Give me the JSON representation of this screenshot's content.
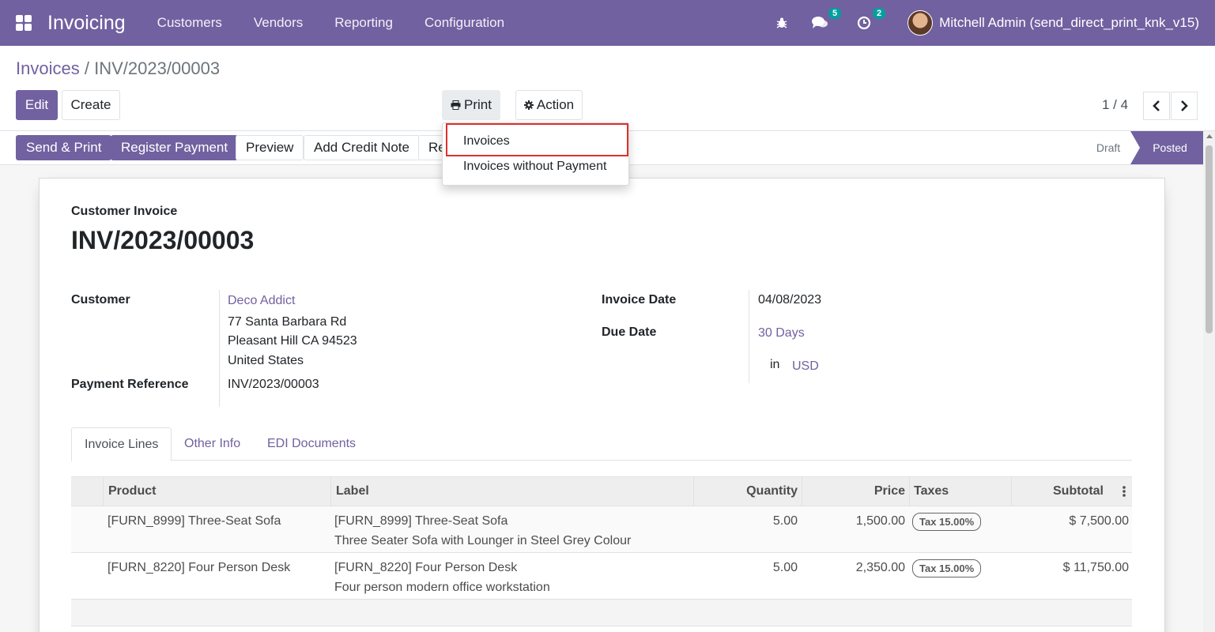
{
  "navbar": {
    "app_name": "Invoicing",
    "menu": [
      "Customers",
      "Vendors",
      "Reporting",
      "Configuration"
    ],
    "messages_count": "5",
    "activities_count": "2",
    "user_name": "Mitchell Admin (send_direct_print_knk_v15)",
    "icons": [
      "apps-icon",
      "bug-icon",
      "chat-icon",
      "clock-icon",
      "user-avatar"
    ]
  },
  "breadcrumb": {
    "parent": "Invoices",
    "separator": "/",
    "current": "INV/2023/00003"
  },
  "buttons": {
    "edit": "Edit",
    "create": "Create",
    "print": "Print",
    "action": "Action"
  },
  "pager": {
    "value": "1 / 4"
  },
  "print_menu": {
    "items": [
      "Invoices",
      "Invoices without Payment"
    ]
  },
  "statusbar": {
    "send_print": "Send & Print",
    "register_payment": "Register Payment",
    "preview": "Preview",
    "add_credit_note": "Add Credit Note",
    "reset_partial": "Re",
    "stages": [
      "Draft",
      "Posted"
    ],
    "active_stage": "Posted"
  },
  "invoice": {
    "type_label": "Customer Invoice",
    "number": "INV/2023/00003",
    "customer_label": "Customer",
    "customer_name": "Deco Addict",
    "address_line1": "77 Santa Barbara Rd",
    "address_line2": "Pleasant Hill CA 94523",
    "address_line3": "United States",
    "payment_ref_label": "Payment Reference",
    "payment_ref": "INV/2023/00003",
    "invoice_date_label": "Invoice Date",
    "invoice_date": "04/08/2023",
    "due_date_label": "Due Date",
    "due_date": "30 Days",
    "currency_prefix": "in",
    "currency": "USD"
  },
  "tabs": [
    "Invoice Lines",
    "Other Info",
    "EDI Documents"
  ],
  "lines_table": {
    "columns": [
      "Product",
      "Label",
      "Quantity",
      "Price",
      "Taxes",
      "Subtotal"
    ],
    "rows": [
      {
        "product": "[FURN_8999] Three-Seat Sofa",
        "label_line1": "[FURN_8999] Three-Seat Sofa",
        "label_line2": "Three Seater Sofa with Lounger in Steel Grey Colour",
        "quantity": "5.00",
        "price": "1,500.00",
        "tax": "Tax 15.00%",
        "subtotal": "$ 7,500.00"
      },
      {
        "product": "[FURN_8220] Four Person Desk",
        "label_line1": "[FURN_8220] Four Person Desk",
        "label_line2": "Four person modern office workstation",
        "quantity": "5.00",
        "price": "2,350.00",
        "tax": "Tax 15.00%",
        "subtotal": "$ 11,750.00"
      }
    ]
  },
  "colors": {
    "brand": "#7161a0",
    "highlight_border": "#e0302c",
    "badge": "#00a09d"
  }
}
